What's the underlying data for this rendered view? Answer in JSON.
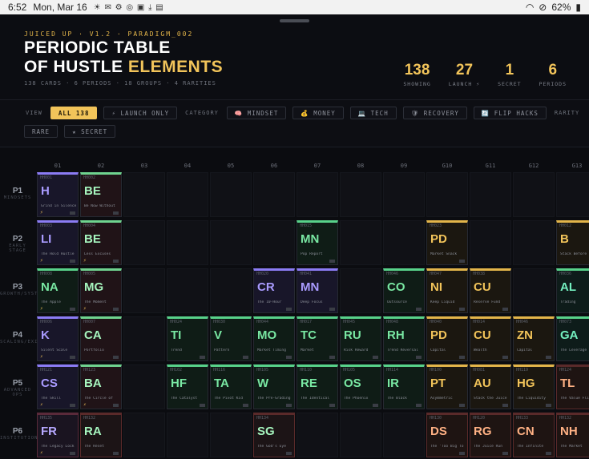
{
  "statusbar": {
    "time": "6:52",
    "date": "Mon, Mar 16",
    "battery": "62%",
    "icons": "☀ ✉ ⚙ ◎ ▣ ⤓ ▤"
  },
  "header": {
    "eyebrow": "JUICED UP · V1.2 · PARADIGM_002",
    "title_line1": "PERIODIC TABLE",
    "title_line2_a": "OF HUSTLE ",
    "title_line2_b": "ELEMENTS",
    "subline": "138 CARDS · 6 PERIODS · 18 GROUPS · 4 RARITIES"
  },
  "stats": [
    {
      "num": "138",
      "label": "SHOWING"
    },
    {
      "num": "27",
      "label": "LAUNCH ⚡"
    },
    {
      "num": "1",
      "label": "SECRET"
    },
    {
      "num": "6",
      "label": "PERIODS"
    }
  ],
  "filters": {
    "view_label": "VIEW",
    "view_all": "ALL 138",
    "view_launch": "⚡ LAUNCH ONLY",
    "category_label": "CATEGORY",
    "categories": [
      "🧠 MINDSET",
      "💰 MONEY",
      "💻 TECH",
      "🛡 RECOVERY",
      "🔄 FLIP HACKS"
    ],
    "rarity_label": "RARITY",
    "rarities": [
      "RARE",
      "★ SECRET"
    ]
  },
  "groups": [
    "01",
    "02",
    "03",
    "04",
    "05",
    "06",
    "07",
    "08",
    "09",
    "G10",
    "G11",
    "G12",
    "G13"
  ],
  "periods": [
    {
      "p": "P1",
      "sub": "MINDSETS"
    },
    {
      "p": "P2",
      "sub": "EARLY STAGE"
    },
    {
      "p": "P3",
      "sub": "GROWTH/SYSTEMS"
    },
    {
      "p": "P4",
      "sub": "SCALING/EXIT"
    },
    {
      "p": "P5",
      "sub": "ADVANCED OPS"
    },
    {
      "p": "P6",
      "sub": "INSTITUTION"
    }
  ],
  "cards": [
    {
      "r": 0,
      "c": 0,
      "id": "HH001",
      "sym": "H",
      "name": "Grind in Silence",
      "color": "purple",
      "icon": "⚡"
    },
    {
      "r": 0,
      "c": 1,
      "id": "HH002",
      "sym": "BE",
      "name": "Be Now Without",
      "color": "pink",
      "icon": ""
    },
    {
      "r": 1,
      "c": 0,
      "id": "HH003",
      "sym": "LI",
      "name": "The Hold Hustle",
      "color": "purple",
      "icon": "⚡"
    },
    {
      "r": 1,
      "c": 1,
      "id": "HH004",
      "sym": "BE",
      "name": "Less Excuses",
      "color": "pink",
      "icon": "⚡"
    },
    {
      "r": 1,
      "c": 6,
      "id": "HH015",
      "sym": "MN",
      "name": "Pop Report",
      "color": "green",
      "icon": ""
    },
    {
      "r": 1,
      "c": 9,
      "id": "HH023",
      "sym": "PD",
      "name": "Market Snack",
      "color": "gold",
      "icon": ""
    },
    {
      "r": 1,
      "c": 12,
      "id": "HH012",
      "sym": "B",
      "name": "Stack Before",
      "color": "gold",
      "icon": ""
    },
    {
      "r": 2,
      "c": 0,
      "id": "HH008",
      "sym": "NA",
      "name": "The Apple",
      "color": "green",
      "icon": "⚡"
    },
    {
      "r": 2,
      "c": 1,
      "id": "HH005",
      "sym": "MG",
      "name": "The Moment",
      "color": "pink",
      "icon": "⚡"
    },
    {
      "r": 2,
      "c": 5,
      "id": "HH020",
      "sym": "CR",
      "name": "The 10-Hour",
      "color": "purple",
      "icon": ""
    },
    {
      "r": 2,
      "c": 6,
      "id": "HH041",
      "sym": "MN",
      "name": "Deep Focus",
      "color": "purple",
      "icon": ""
    },
    {
      "r": 2,
      "c": 8,
      "id": "HH046",
      "sym": "CO",
      "name": "Outsource",
      "color": "green",
      "icon": ""
    },
    {
      "r": 2,
      "c": 9,
      "id": "HH047",
      "sym": "NI",
      "name": "Keep Liquid",
      "color": "gold",
      "icon": ""
    },
    {
      "r": 2,
      "c": 10,
      "id": "HH038",
      "sym": "CU",
      "name": "Reserve Fund",
      "color": "gold",
      "icon": ""
    },
    {
      "r": 2,
      "c": 12,
      "id": "HH036",
      "sym": "AL",
      "name": "Trading",
      "color": "teal",
      "icon": ""
    },
    {
      "r": 3,
      "c": 0,
      "id": "HH006",
      "sym": "K",
      "name": "Silent Scale",
      "color": "purple",
      "icon": "⚡"
    },
    {
      "r": 3,
      "c": 1,
      "id": "HH007",
      "sym": "CA",
      "name": "Portfolio",
      "color": "pink",
      "icon": ""
    },
    {
      "r": 3,
      "c": 3,
      "id": "HH024",
      "sym": "TI",
      "name": "Trend",
      "color": "green",
      "icon": ""
    },
    {
      "r": 3,
      "c": 4,
      "id": "HH030",
      "sym": "V",
      "name": "Pattern",
      "color": "green",
      "icon": ""
    },
    {
      "r": 3,
      "c": 5,
      "id": "HH044",
      "sym": "MO",
      "name": "Market Timing",
      "color": "green",
      "icon": ""
    },
    {
      "r": 3,
      "c": 6,
      "id": "HH017",
      "sym": "TC",
      "name": "Market",
      "color": "green",
      "icon": ""
    },
    {
      "r": 3,
      "c": 7,
      "id": "HH045",
      "sym": "RU",
      "name": "Risk Reward",
      "color": "green",
      "icon": ""
    },
    {
      "r": 3,
      "c": 8,
      "id": "HH048",
      "sym": "RH",
      "name": "Trend Reversal",
      "color": "green",
      "icon": ""
    },
    {
      "r": 3,
      "c": 9,
      "id": "HH040",
      "sym": "PD",
      "name": "Capital",
      "color": "gold",
      "icon": ""
    },
    {
      "r": 3,
      "c": 10,
      "id": "HH014",
      "sym": "CU",
      "name": "Wealth",
      "color": "gold",
      "icon": ""
    },
    {
      "r": 3,
      "c": 11,
      "id": "HH046",
      "sym": "ZN",
      "name": "Capital",
      "color": "gold",
      "icon": ""
    },
    {
      "r": 3,
      "c": 12,
      "id": "HH073",
      "sym": "GA",
      "name": "The Leverage",
      "color": "teal",
      "icon": ""
    },
    {
      "r": 4,
      "c": 0,
      "id": "HH121",
      "sym": "CS",
      "name": "The Skill",
      "color": "purple",
      "icon": "⚡"
    },
    {
      "r": 4,
      "c": 1,
      "id": "HH123",
      "sym": "BA",
      "name": "The Circle of",
      "color": "pink",
      "icon": "⚡"
    },
    {
      "r": 4,
      "c": 3,
      "id": "HH102",
      "sym": "HF",
      "name": "The Catalyst",
      "color": "green",
      "icon": ""
    },
    {
      "r": 4,
      "c": 4,
      "id": "HH116",
      "sym": "TA",
      "name": "The Pivot Kid",
      "color": "green",
      "icon": ""
    },
    {
      "r": 4,
      "c": 5,
      "id": "HH105",
      "sym": "W",
      "name": "The Pre-Grading",
      "color": "green",
      "icon": ""
    },
    {
      "r": 4,
      "c": 6,
      "id": "HH110",
      "sym": "RE",
      "name": "The Identical",
      "color": "green",
      "icon": ""
    },
    {
      "r": 4,
      "c": 7,
      "id": "HH105",
      "sym": "OS",
      "name": "The Phoenix",
      "color": "green",
      "icon": ""
    },
    {
      "r": 4,
      "c": 8,
      "id": "HH114",
      "sym": "IR",
      "name": "The Black",
      "color": "green",
      "icon": ""
    },
    {
      "r": 4,
      "c": 9,
      "id": "HH100",
      "sym": "PT",
      "name": "Asymmetric",
      "color": "gold",
      "icon": ""
    },
    {
      "r": 4,
      "c": 10,
      "id": "HH081",
      "sym": "AU",
      "name": "Stack the Juice",
      "color": "gold",
      "icon": ""
    },
    {
      "r": 4,
      "c": 11,
      "id": "HH119",
      "sym": "HG",
      "name": "The Liquidity",
      "color": "gold",
      "icon": ""
    },
    {
      "r": 4,
      "c": 12,
      "id": "HH124",
      "sym": "TL",
      "name": "The Value Flip",
      "color": "red",
      "icon": ""
    },
    {
      "r": 5,
      "c": 0,
      "id": "HH135",
      "sym": "FR",
      "name": "The Legacy Lock",
      "color": "redp",
      "icon": "⚡"
    },
    {
      "r": 5,
      "c": 1,
      "id": "HH132",
      "sym": "RA",
      "name": "The Reset",
      "color": "redg",
      "icon": ""
    },
    {
      "r": 5,
      "c": 5,
      "id": "HH134",
      "sym": "SG",
      "name": "The God's Eye",
      "color": "redg",
      "icon": ""
    },
    {
      "r": 5,
      "c": 9,
      "id": "HH130",
      "sym": "DS",
      "name": "The 'Too Big To",
      "color": "red",
      "icon": ""
    },
    {
      "r": 5,
      "c": 10,
      "id": "HH120",
      "sym": "RG",
      "name": "The Juice Run",
      "color": "red",
      "icon": ""
    },
    {
      "r": 5,
      "c": 11,
      "id": "HH133",
      "sym": "CN",
      "name": "The Infinite",
      "color": "red",
      "icon": ""
    },
    {
      "r": 5,
      "c": 12,
      "id": "HH132",
      "sym": "NH",
      "name": "The Market",
      "color": "red",
      "icon": ""
    }
  ]
}
